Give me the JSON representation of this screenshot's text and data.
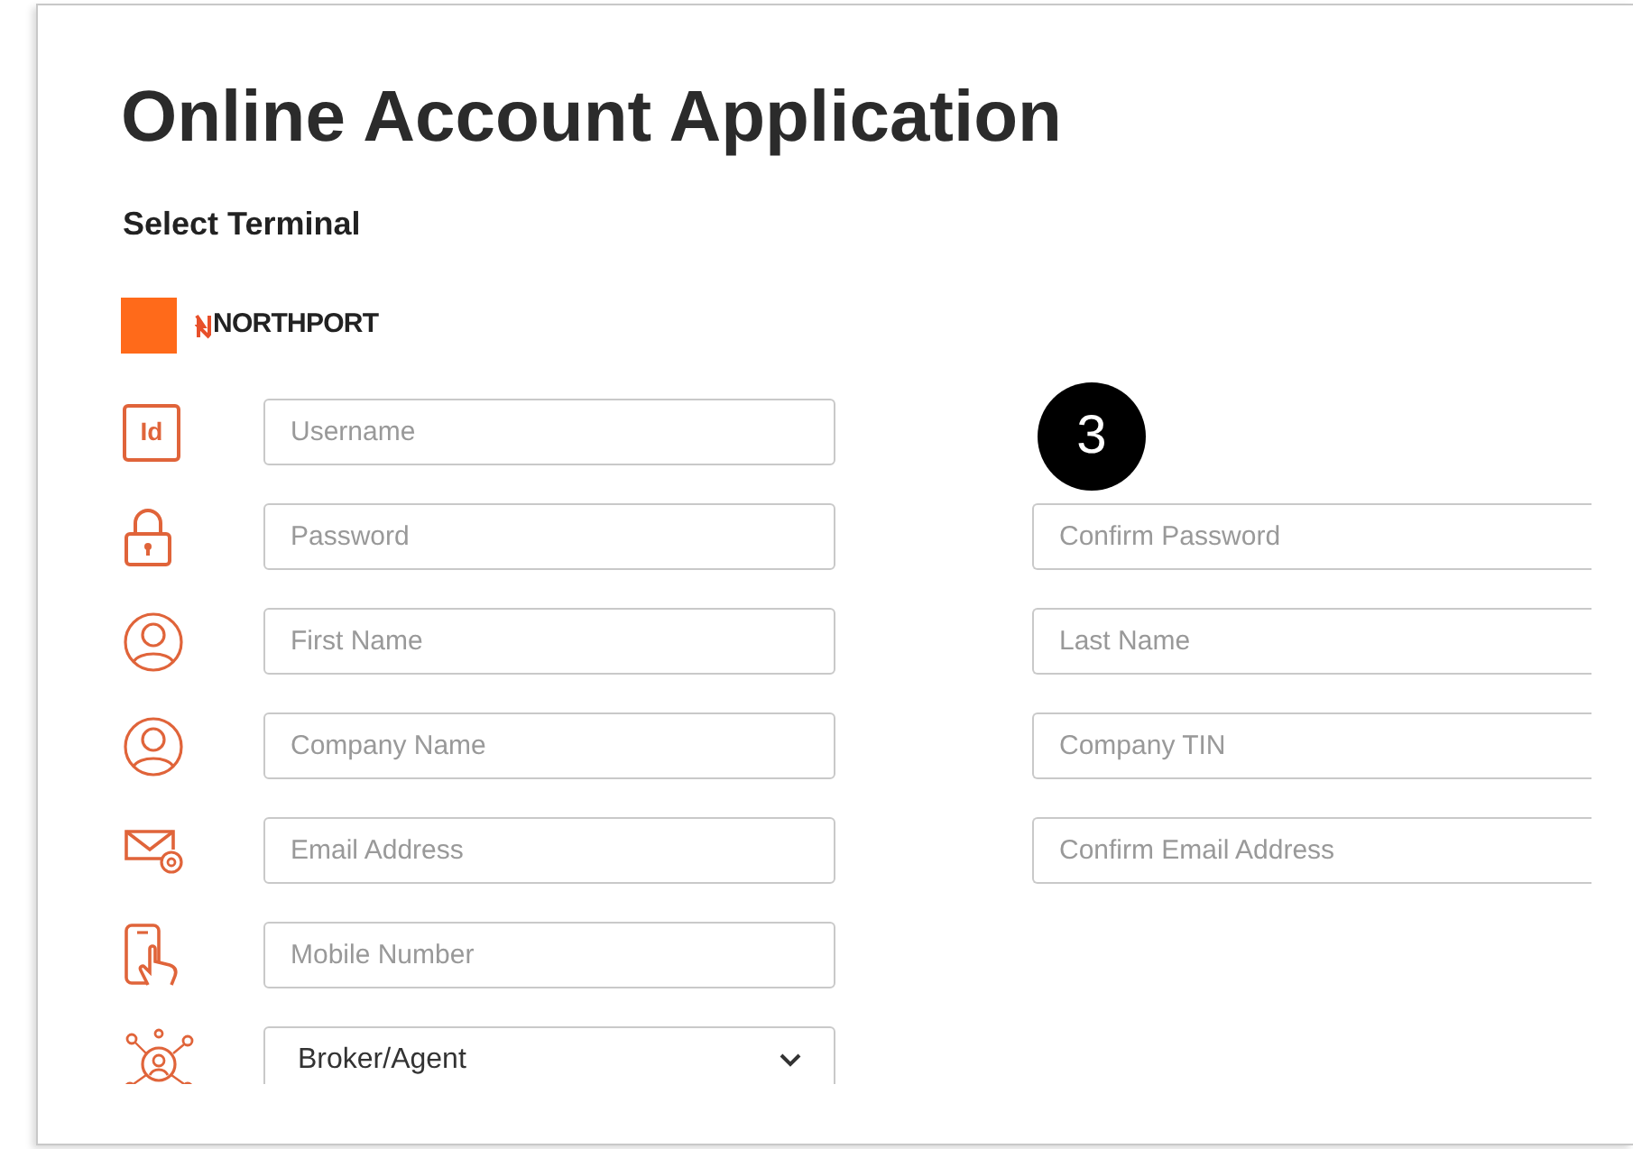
{
  "title": "Online Account Application",
  "section_label": "Select Terminal",
  "terminal": {
    "name": "NORTHPORT"
  },
  "left_fields": [
    {
      "icon_label": "Id",
      "kind": "input",
      "placeholder": "Username"
    },
    {
      "kind": "input",
      "placeholder": "Password"
    },
    {
      "kind": "input",
      "placeholder": "First Name"
    },
    {
      "kind": "input",
      "placeholder": "Company Name"
    },
    {
      "kind": "input",
      "placeholder": "Email Address"
    },
    {
      "kind": "input",
      "placeholder": "Mobile Number"
    },
    {
      "kind": "select",
      "value": "Broker/Agent"
    }
  ],
  "step_badge": "3",
  "right_fields": [
    {
      "placeholder": "Confirm Password"
    },
    {
      "placeholder": "Last Name"
    },
    {
      "placeholder": "Company TIN"
    },
    {
      "placeholder": "Confirm Email Address"
    }
  ]
}
